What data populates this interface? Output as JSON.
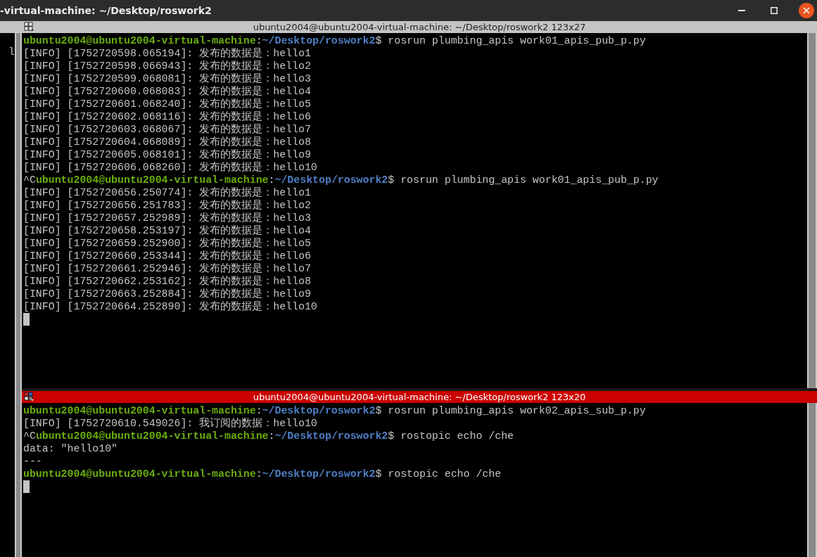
{
  "window": {
    "title": "-virtual-machine: ~/Desktop/roswork2"
  },
  "left_pane": {
    "text": "l"
  },
  "panes": [
    {
      "title": "ubuntu2004@ubuntu2004-virtual-machine: ~/Desktop/roswork2 123x27",
      "focused": false,
      "lines": [
        {
          "kind": "prompt",
          "user": "ubuntu2004@ubuntu2004-virtual-machine",
          "separator": ":",
          "path": "~/Desktop/roswork2",
          "command": "$ rosrun plumbing_apis work01_apis_pub_p.py"
        },
        {
          "kind": "output",
          "text": "[INFO] [1752720598.065194]: 发布的数据是：hello1"
        },
        {
          "kind": "output",
          "text": "[INFO] [1752720598.066943]: 发布的数据是：hello2"
        },
        {
          "kind": "output",
          "text": "[INFO] [1752720599.068081]: 发布的数据是：hello3"
        },
        {
          "kind": "output",
          "text": "[INFO] [1752720600.068083]: 发布的数据是：hello4"
        },
        {
          "kind": "output",
          "text": "[INFO] [1752720601.068240]: 发布的数据是：hello5"
        },
        {
          "kind": "output",
          "text": "[INFO] [1752720602.068116]: 发布的数据是：hello6"
        },
        {
          "kind": "output",
          "text": "[INFO] [1752720603.068067]: 发布的数据是：hello7"
        },
        {
          "kind": "output",
          "text": "[INFO] [1752720604.068089]: 发布的数据是：hello8"
        },
        {
          "kind": "output",
          "text": "[INFO] [1752720605.068101]: 发布的数据是：hello9"
        },
        {
          "kind": "output",
          "text": "[INFO] [1752720606.068260]: 发布的数据是：hello10"
        },
        {
          "kind": "prompt",
          "prefix": "^C",
          "user": "ubuntu2004@ubuntu2004-virtual-machine",
          "separator": ":",
          "path": "~/Desktop/roswork2",
          "command": "$ rosrun plumbing_apis work01_apis_pub_p.py"
        },
        {
          "kind": "output",
          "text": "[INFO] [1752720656.250774]: 发布的数据是：hello1"
        },
        {
          "kind": "output",
          "text": "[INFO] [1752720656.251783]: 发布的数据是：hello2"
        },
        {
          "kind": "output",
          "text": "[INFO] [1752720657.252989]: 发布的数据是：hello3"
        },
        {
          "kind": "output",
          "text": "[INFO] [1752720658.253197]: 发布的数据是：hello4"
        },
        {
          "kind": "output",
          "text": "[INFO] [1752720659.252900]: 发布的数据是：hello5"
        },
        {
          "kind": "output",
          "text": "[INFO] [1752720660.253344]: 发布的数据是：hello6"
        },
        {
          "kind": "output",
          "text": "[INFO] [1752720661.252946]: 发布的数据是：hello7"
        },
        {
          "kind": "output",
          "text": "[INFO] [1752720662.253162]: 发布的数据是：hello8"
        },
        {
          "kind": "output",
          "text": "[INFO] [1752720663.252884]: 发布的数据是：hello9"
        },
        {
          "kind": "output",
          "text": "[INFO] [1752720664.252890]: 发布的数据是：hello10"
        },
        {
          "kind": "cursor"
        }
      ]
    },
    {
      "title": "ubuntu2004@ubuntu2004-virtual-machine: ~/Desktop/roswork2 123x20",
      "focused": true,
      "lines": [
        {
          "kind": "prompt",
          "user": "ubuntu2004@ubuntu2004-virtual-machine",
          "separator": ":",
          "path": "~/Desktop/roswork2",
          "command": "$ rosrun plumbing_apis work02_apis_sub_p.py"
        },
        {
          "kind": "output",
          "text": "[INFO] [1752720610.549026]: 我订阅的数据：hello10"
        },
        {
          "kind": "prompt",
          "prefix": "^C",
          "user": "ubuntu2004@ubuntu2004-virtual-machine",
          "separator": ":",
          "path": "~/Desktop/roswork2",
          "command": "$ rostopic echo /che"
        },
        {
          "kind": "output",
          "text": "data: \"hello10\""
        },
        {
          "kind": "output",
          "text": "---"
        },
        {
          "kind": "prompt",
          "user": "ubuntu2004@ubuntu2004-virtual-machine",
          "separator": ":",
          "path": "~/Desktop/roswork2",
          "command": "$ rostopic echo /che"
        },
        {
          "kind": "cursor"
        }
      ]
    }
  ]
}
